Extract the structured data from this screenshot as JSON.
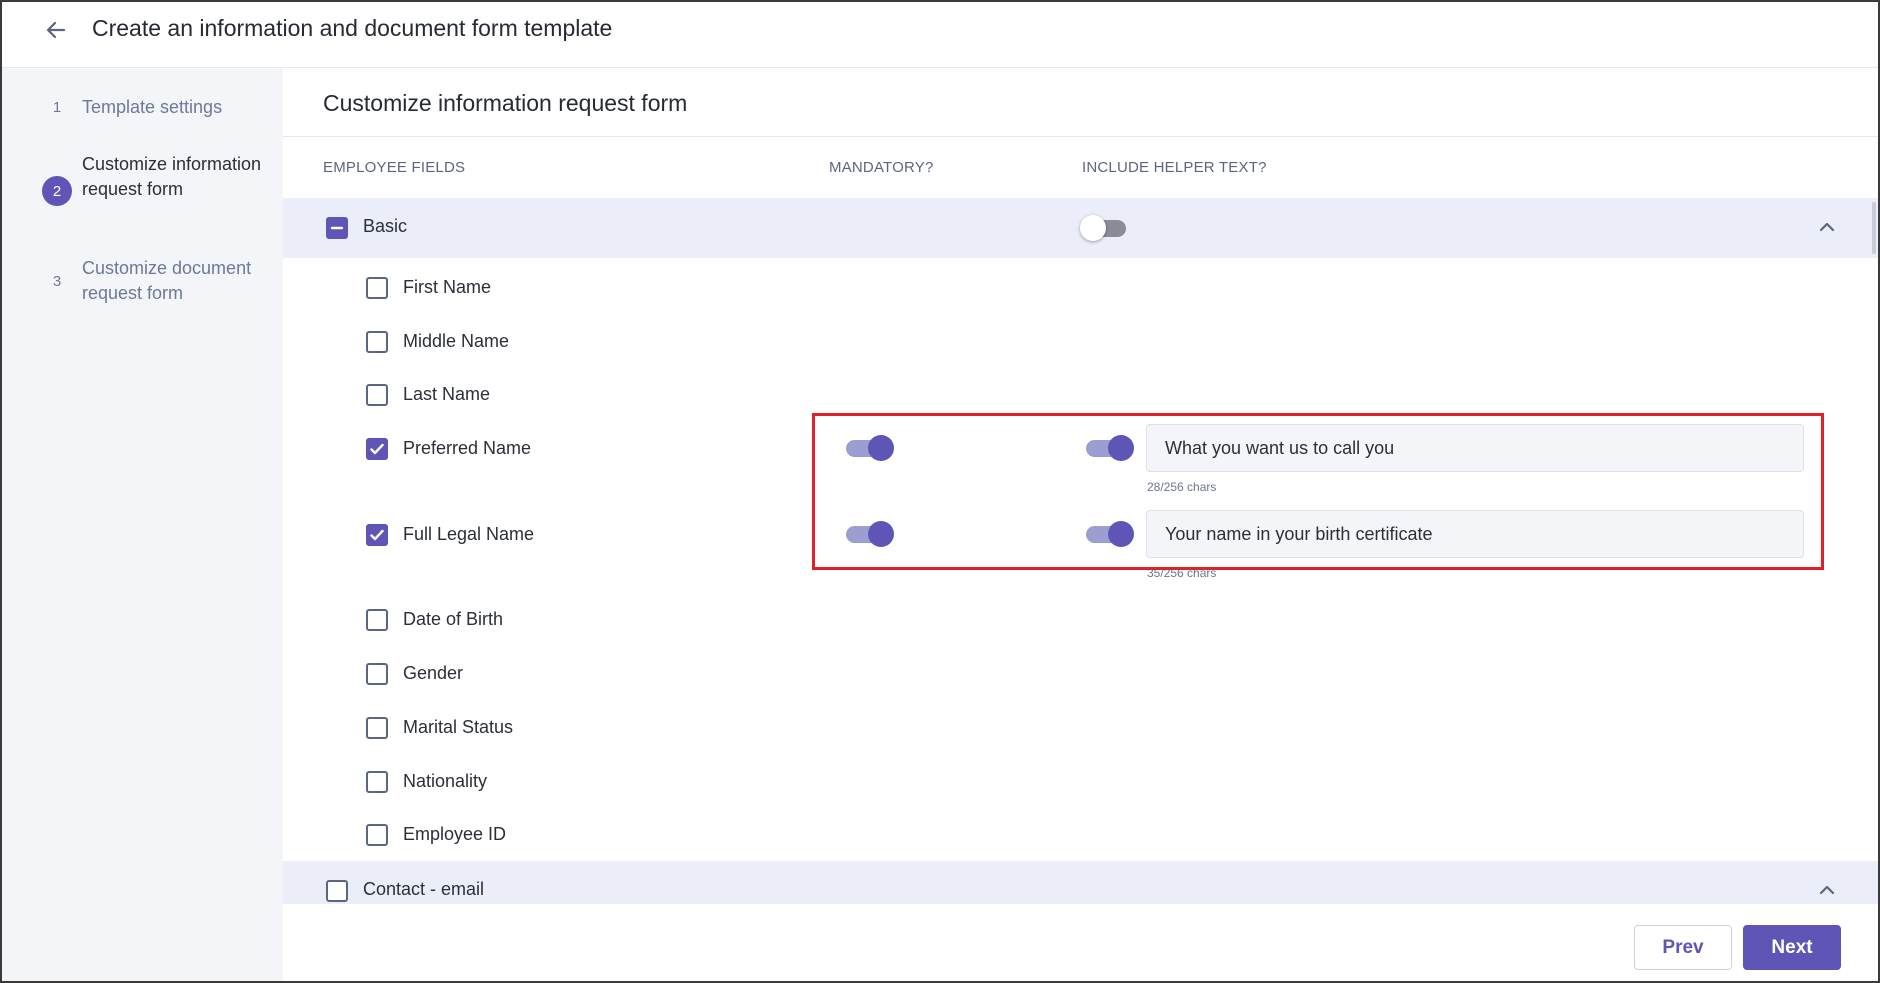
{
  "header": {
    "title": "Create an information and document form template"
  },
  "steps": [
    {
      "num": "1",
      "label": "Template settings"
    },
    {
      "num": "2",
      "label": "Customize information request form"
    },
    {
      "num": "3",
      "label": "Customize document request form"
    }
  ],
  "section_title": "Customize information request form",
  "columns": {
    "employee_fields": "EMPLOYEE FIELDS",
    "mandatory": "MANDATORY?",
    "helper": "INCLUDE HELPER TEXT?"
  },
  "groups": [
    {
      "title": "Basic",
      "state": "partial",
      "helper_toggle": "off"
    },
    {
      "title": "Contact - email",
      "state": "unchecked"
    }
  ],
  "fields": [
    {
      "label": "First Name",
      "checked": false
    },
    {
      "label": "Middle Name",
      "checked": false
    },
    {
      "label": "Last Name",
      "checked": false
    },
    {
      "label": "Preferred Name",
      "checked": true,
      "mandatory": true,
      "helper_on": true,
      "helper_text": "What you want us to call you",
      "chars": "28/256 chars"
    },
    {
      "label": "Full Legal Name",
      "checked": true,
      "mandatory": true,
      "helper_on": true,
      "helper_text": "Your name in your birth certificate",
      "chars": "35/256 chars"
    },
    {
      "label": "Date of Birth",
      "checked": false
    },
    {
      "label": "Gender",
      "checked": false
    },
    {
      "label": "Marital Status",
      "checked": false
    },
    {
      "label": "Nationality",
      "checked": false
    },
    {
      "label": "Employee ID",
      "checked": false
    }
  ],
  "buttons": {
    "prev": "Prev",
    "next": "Next"
  },
  "colors": {
    "accent": "#5e55b7",
    "highlight": "#e0202a",
    "group_bg": "#ebedf8"
  }
}
